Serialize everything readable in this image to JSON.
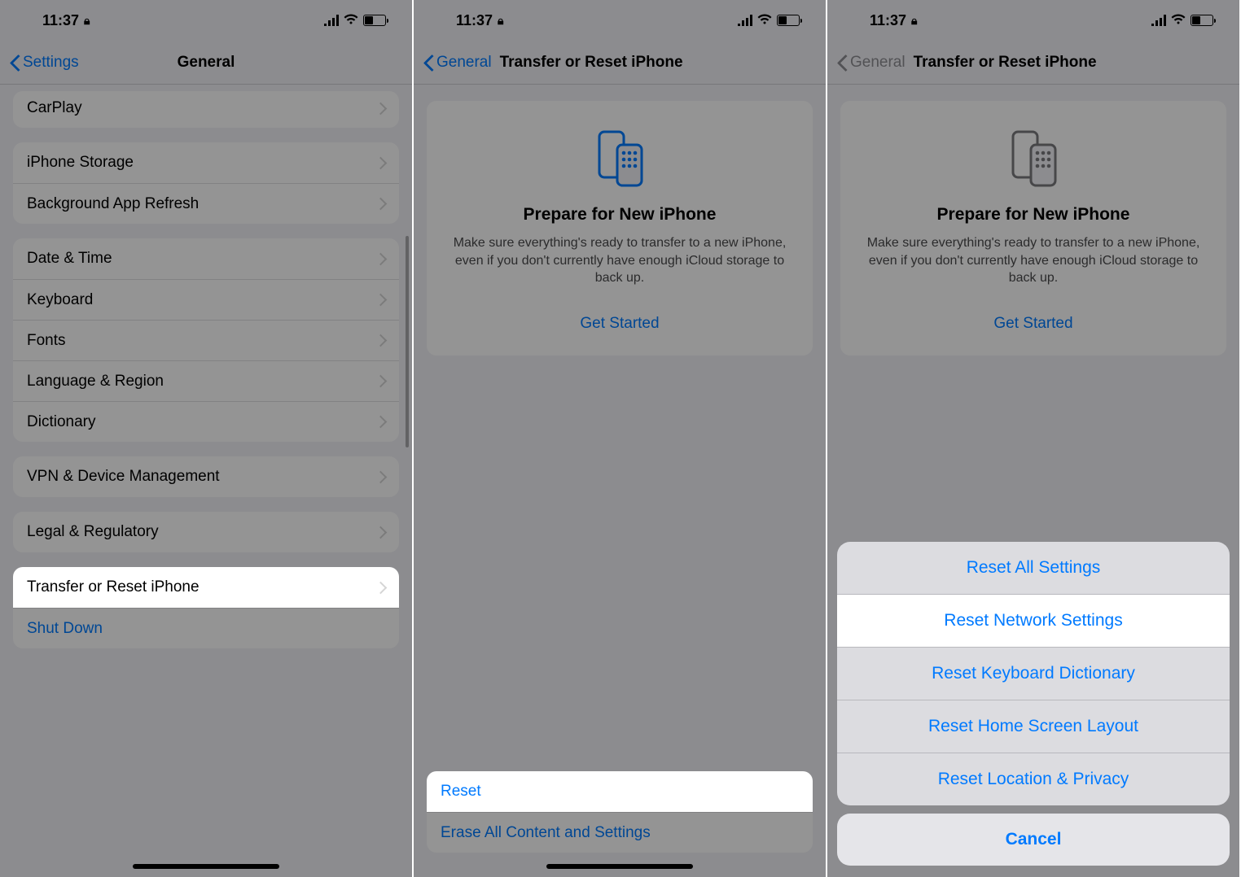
{
  "status": {
    "time": "11:37",
    "lock_icon": "lock-icon"
  },
  "screen1": {
    "back_label": "Settings",
    "title": "General",
    "rows": {
      "carplay": "CarPlay",
      "iphone_storage": "iPhone Storage",
      "bg_refresh": "Background App Refresh",
      "date_time": "Date & Time",
      "keyboard": "Keyboard",
      "fonts": "Fonts",
      "lang_region": "Language & Region",
      "dictionary": "Dictionary",
      "vpn": "VPN & Device Management",
      "legal": "Legal & Regulatory",
      "transfer_reset": "Transfer or Reset iPhone",
      "shut_down": "Shut Down"
    }
  },
  "screen2": {
    "back_label": "General",
    "title": "Transfer or Reset iPhone",
    "card": {
      "heading": "Prepare for New iPhone",
      "body": "Make sure everything's ready to transfer to a new iPhone, even if you don't currently have enough iCloud storage to back up.",
      "cta": "Get Started"
    },
    "reset": "Reset",
    "erase": "Erase All Content and Settings"
  },
  "screen3": {
    "back_label": "General",
    "title": "Transfer or Reset iPhone",
    "card": {
      "heading": "Prepare for New iPhone",
      "body": "Make sure everything's ready to transfer to a new iPhone, even if you don't currently have enough iCloud storage to back up.",
      "cta": "Get Started"
    },
    "sheet": {
      "reset_all": "Reset All Settings",
      "reset_network": "Reset Network Settings",
      "reset_keyboard": "Reset Keyboard Dictionary",
      "reset_home": "Reset Home Screen Layout",
      "reset_location": "Reset Location & Privacy",
      "cancel": "Cancel"
    }
  }
}
